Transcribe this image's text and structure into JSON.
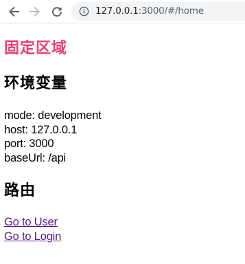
{
  "browser": {
    "url_host": "127.0.0.1",
    "url_rest": ":3000/#/home",
    "icons": {
      "back": "arrow-left-icon",
      "forward": "arrow-right-icon",
      "reload": "reload-icon",
      "info": "info-icon"
    }
  },
  "page": {
    "fixed_area_title": "固定区域",
    "env_heading": "环境变量",
    "env_lines": [
      "mode: development",
      "host: 127.0.0.1",
      "port: 3000",
      "baseUrl: /api"
    ],
    "route_heading": "路由",
    "links": [
      "Go to User",
      "Go to Login"
    ]
  },
  "colors": {
    "accent_title": "#f03c6e",
    "visited_link": "#551a8b",
    "omnibox_bg": "#f1f3f4"
  }
}
